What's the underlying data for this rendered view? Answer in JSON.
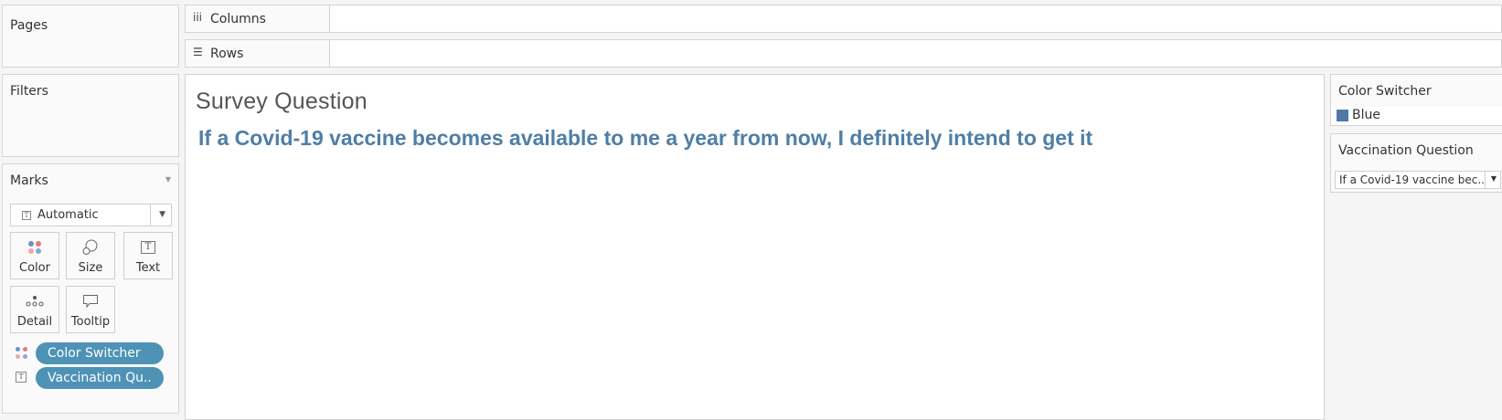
{
  "left": {
    "pages_title": "Pages",
    "filters_title": "Filters",
    "marks_title": "Marks",
    "mark_type": "Automatic",
    "mark_buttons": {
      "color": "Color",
      "size": "Size",
      "text": "Text",
      "detail": "Detail",
      "tooltip": "Tooltip"
    },
    "pills": [
      {
        "label": "Color Switcher",
        "icon": "color-dots-icon"
      },
      {
        "label": "Vaccination Qu..",
        "icon": "text-icon"
      }
    ]
  },
  "shelves": {
    "columns": {
      "label": "Columns",
      "icon": "columns-icon"
    },
    "rows": {
      "label": "Rows",
      "icon": "rows-icon"
    }
  },
  "view": {
    "title": "Survey Question",
    "text": "If a Covid-19 vaccine becomes available to me a year from now, I definitely intend to get it",
    "text_color": "#4f7ea5"
  },
  "color_legend": {
    "title": "Color Switcher",
    "items": [
      {
        "label": "Blue",
        "color": "#4e79a7"
      }
    ]
  },
  "parameter": {
    "title": "Vaccination Question",
    "value": "If a Covid-19 vaccine bec..."
  },
  "colors": {
    "pill": "#4e93b6",
    "accent": "#4e79a7"
  }
}
